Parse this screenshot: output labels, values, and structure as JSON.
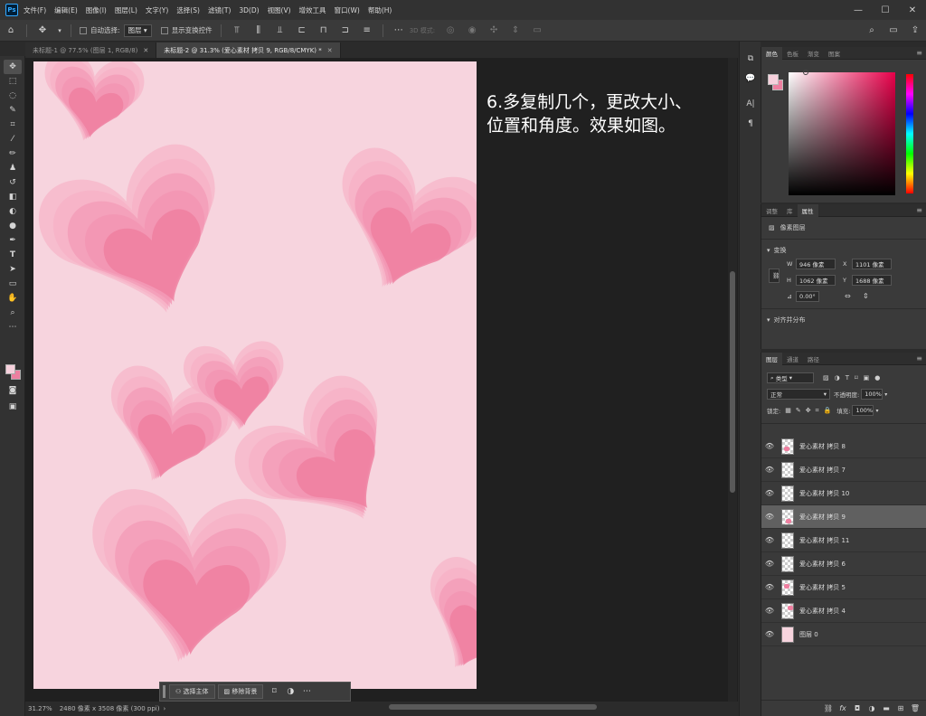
{
  "menubar": {
    "items": [
      "文件(F)",
      "编辑(E)",
      "图像(I)",
      "图层(L)",
      "文字(Y)",
      "选择(S)",
      "滤镜(T)",
      "3D(D)",
      "视图(V)",
      "增效工具",
      "窗口(W)",
      "帮助(H)"
    ]
  },
  "window_controls": [
    "—",
    "☐",
    "✕"
  ],
  "options_bar": {
    "auto_select_label": "自动选择:",
    "auto_select_value": "图层",
    "show_transform_label": "显示变换控件",
    "mode3d_label": "3D 模式:"
  },
  "tabs": [
    {
      "title": "未标题-1 @ 77.5% (图层 1, RGB/8)",
      "close": "✕"
    },
    {
      "title": "未标题-2 @ 31.3% (爱心素材 拷贝 9, RGB/8/CMYK) *",
      "close": "✕"
    }
  ],
  "canvas": {
    "bg_color": "#f7d4de",
    "heart_light": "#f6b3c8",
    "heart_mid": "#f295b3",
    "heart_dark": "#ee7fa0",
    "instruction_line1": "6.多复制几个，更改大小、",
    "instruction_line2": "位置和角度。效果如图。"
  },
  "context_bar": {
    "select_subject": "选择主体",
    "remove_bg": "移除背景"
  },
  "status": {
    "zoom": "31.27%",
    "doc_info": "2480 像素 x 3508 像素 (300 ppi)"
  },
  "color_panel": {
    "tabs": [
      "颜色",
      "色板",
      "渐变",
      "图案"
    ],
    "fg": "#f6d0dc",
    "bg": "#ee7fa0"
  },
  "properties_panel": {
    "tabs": [
      "调整",
      "库",
      "属性"
    ],
    "type_label": "像素图层",
    "transform_label": "变换",
    "w_label": "W",
    "w_value": "946 像素",
    "x_label": "X",
    "x_value": "1101 像素",
    "h_label": "H",
    "h_value": "1062 像素",
    "y_label": "Y",
    "y_value": "1688 像素",
    "angle_value": "0.00°",
    "align_label": "对齐并分布"
  },
  "layers_panel": {
    "tabs": [
      "图层",
      "通道",
      "路径"
    ],
    "filter_label": "类型",
    "blend_mode": "正常",
    "opacity_label": "不透明度:",
    "opacity_value": "100%",
    "lock_label": "锁定:",
    "fill_label": "填充:",
    "fill_value": "100%",
    "layers": [
      {
        "name": "爱心素材 拷贝 8",
        "selected": false
      },
      {
        "name": "爱心素材 拷贝 7",
        "selected": false
      },
      {
        "name": "爱心素材 拷贝 10",
        "selected": false
      },
      {
        "name": "爱心素材 拷贝 9",
        "selected": true
      },
      {
        "name": "爱心素材 拷贝 11",
        "selected": false
      },
      {
        "name": "爱心素材 拷贝 6",
        "selected": false
      },
      {
        "name": "爱心素材 拷贝 5",
        "selected": false
      },
      {
        "name": "爱心素材 拷贝 4",
        "selected": false
      },
      {
        "name": "图层 0",
        "selected": false
      }
    ]
  }
}
